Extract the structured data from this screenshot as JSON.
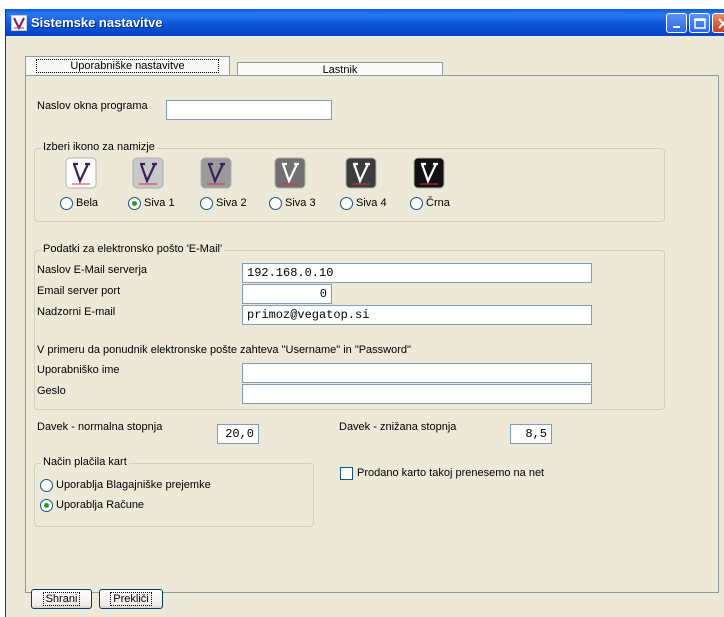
{
  "window": {
    "title": "Sistemske nastavitve"
  },
  "tabs": [
    {
      "label": "Uporabniške nastavitve"
    },
    {
      "label": "Lastnik"
    }
  ],
  "program": {
    "title_label": "Naslov okna programa",
    "title_value": ""
  },
  "icons": {
    "legend": "Izberi ikono za namizje",
    "options": [
      {
        "label": "Bela",
        "color": "#ffffff"
      },
      {
        "label": "Siva 1",
        "color": "#c8c8c8"
      },
      {
        "label": "Siva 2",
        "color": "#9a9a9a"
      },
      {
        "label": "Siva 3",
        "color": "#707070"
      },
      {
        "label": "Siva 4",
        "color": "#3c3c3c"
      },
      {
        "label": "Črna",
        "color": "#111111"
      }
    ],
    "selected": "Siva 1"
  },
  "email": {
    "legend": "Podatki za elektronsko pošto 'E-Mail'",
    "server_label": "Naslov E-Mail serverja",
    "server_value": "192.168.0.10",
    "port_label": "Email server port",
    "port_value": "0",
    "supervisor_label": "Nadzorni E-mail",
    "supervisor_value": "primoz@vegatop.si",
    "auth_note": "V primeru da ponudnik elektronske pošte zahteva \"Username\" in \"Password\"",
    "username_label": "Uporabniško ime",
    "username_value": "",
    "password_label": "Geslo",
    "password_value": ""
  },
  "tax": {
    "normal_label": "Davek - normalna stopnja",
    "normal_value": "20,0",
    "reduced_label": "Davek - znižana stopnja",
    "reduced_value": "8,5"
  },
  "payment": {
    "legend": "Način plačila kart",
    "options": [
      {
        "label": "Uporablja Blagajniške prejemke"
      },
      {
        "label": "Uporablja Račune"
      }
    ],
    "selected": "Uporablja Račune"
  },
  "transfer": {
    "label": "Prodano karto takoj prenesemo na net",
    "checked": false
  },
  "buttons": {
    "save": "Shrani",
    "cancel": "Prekliči"
  }
}
